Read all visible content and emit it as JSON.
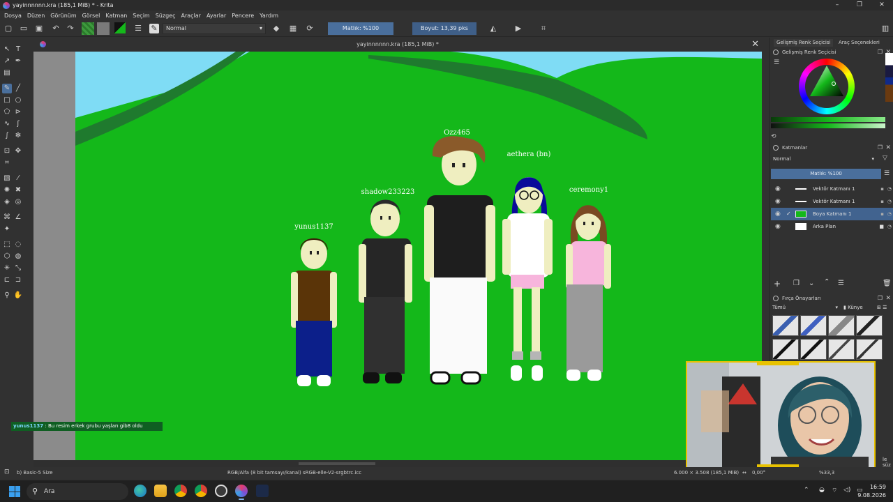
{
  "window": {
    "title": "yayinnnnnn.kra (185,1 MiB) * - Krita",
    "controls": [
      "–",
      "❐",
      "✕"
    ]
  },
  "menu": [
    "Dosya",
    "Düzen",
    "Görünüm",
    "Görsel",
    "Katman",
    "Seçim",
    "Süzgeç",
    "Araçlar",
    "Ayarlar",
    "Pencere",
    "Yardım"
  ],
  "toolbar": {
    "blend_mode": "Normal",
    "opacity_label": "Matlık: %100",
    "size_label": "Boyut: 13,39 pks"
  },
  "document": {
    "tab_title": "yayinnnnnn.kra (185,1 MiB) *",
    "close": "✕"
  },
  "drawing": {
    "characters": [
      {
        "name": "yunus1137"
      },
      {
        "name": "shadow233223"
      },
      {
        "name": "Ozz465"
      },
      {
        "name": "aethera (bn)"
      },
      {
        "name": "ceremony1"
      }
    ],
    "colors": {
      "sky": "#7fdcf5",
      "grass": "#14b81a",
      "hill_line": "#1f7a2e"
    }
  },
  "chat": {
    "user": "yunus1137",
    "message": " : Bu resim erkek grubu yaşları gib8 oldu"
  },
  "dock": {
    "tabs": [
      "Gelişmiş Renk Seçicisi",
      "Araç Seçenekleri"
    ],
    "color_panel_title": "Gelişmiş Renk Seçicisi",
    "layers_title": "Katmanlar",
    "layers_blend": "Normal",
    "layers_opacity": "Matlık: %100",
    "layers": [
      {
        "name": "Vektör Katmanı 1",
        "selected": false
      },
      {
        "name": "Vektör Katmanı 1",
        "selected": false
      },
      {
        "name": "Boya Katmanı 1",
        "selected": true
      },
      {
        "name": "Arka Plan",
        "selected": false
      }
    ],
    "brush_title": "Fırça Önayarları",
    "brush_filter": "Tümü",
    "brush_tag": "Künye",
    "filter_text": "le süz"
  },
  "status": {
    "brush": "b) Basic-5 Size",
    "colorspace": "RGB/Alfa (8 bit tamsayı/kanal) sRGB-elle-V2-srgbtrc.icc",
    "dimensions": "6.000 × 3.508 (185,1 MiB)",
    "rotation": "0,00°",
    "zoom": "%33,3"
  },
  "taskbar": {
    "search": "Ara",
    "time": "16:59",
    "date": "9.08.2026"
  }
}
